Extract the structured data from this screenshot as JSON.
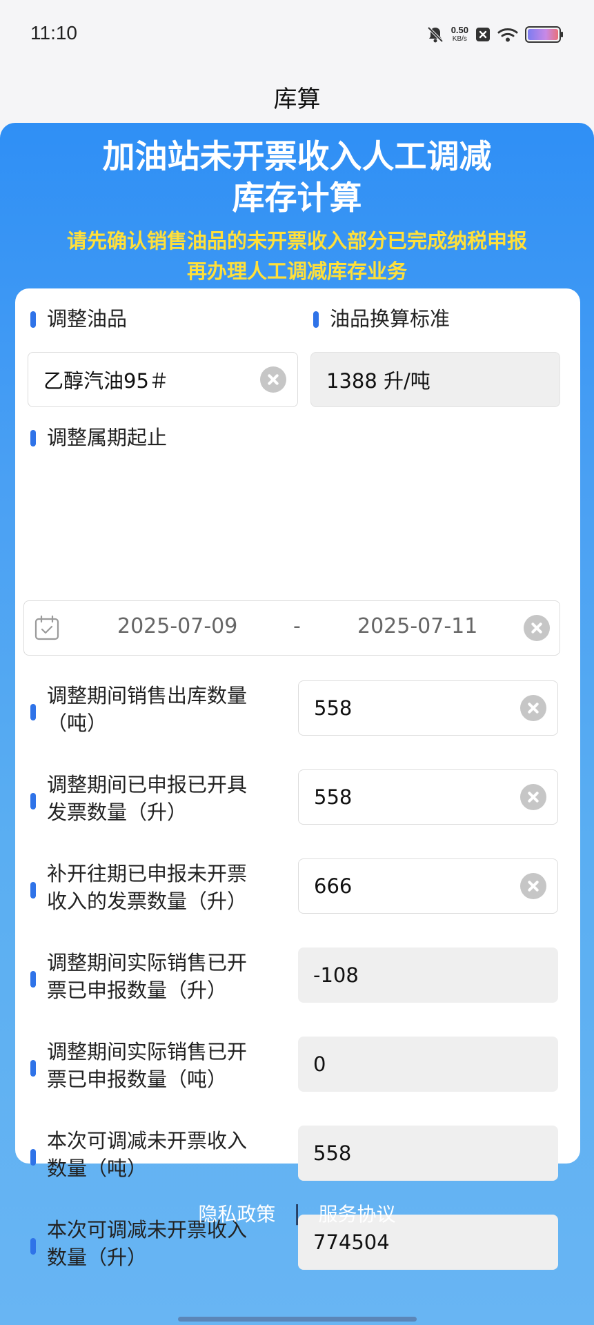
{
  "status_bar": {
    "time": "11:10",
    "net_speed_value": "0.50",
    "net_speed_unit": "KB/s",
    "icons": [
      "bell-muted-icon",
      "close-box-icon",
      "wifi-icon",
      "battery-icon"
    ]
  },
  "nav": {
    "title": "库算"
  },
  "banner": {
    "title_line1": "加油站未开票收入人工调减",
    "title_line2": "库存计算",
    "note_line1": "请先确认销售油品的未开票收入部分已完成纳税申报",
    "note_line2": "再办理人工调减库存业务"
  },
  "form": {
    "oil_label": "调整油品",
    "oil_value": "乙醇汽油95＃",
    "conversion_label": "油品换算标准",
    "conversion_value": "1388 升/吨",
    "period_label": "调整属期起止",
    "period_start": "2025-07-09",
    "period_separator": "-",
    "period_end": "2025-07-11",
    "rows": [
      {
        "label_line1": "调整期间销售出库数量",
        "label_line2": "（吨）",
        "value": "558",
        "editable": true
      },
      {
        "label_line1": "调整期间已申报已开具",
        "label_line2": "发票数量（升）",
        "value": "558",
        "editable": true
      },
      {
        "label_line1": "补开往期已申报未开票",
        "label_line2": "收入的发票数量（升）",
        "value": "666",
        "editable": true
      },
      {
        "label_line1": "调整期间实际销售已开",
        "label_line2": "票已申报数量（升）",
        "value": "-108",
        "editable": false
      },
      {
        "label_line1": "调整期间实际销售已开",
        "label_line2": "票已申报数量（吨）",
        "value": "0",
        "editable": false
      },
      {
        "label_line1": "本次可调减未开票收入",
        "label_line2": "数量（吨）",
        "value": "558",
        "editable": false
      },
      {
        "label_line1": "本次可调减未开票收入",
        "label_line2": "数量（升）",
        "value": "774504",
        "editable": false
      }
    ]
  },
  "footer": {
    "privacy_link": "隐私政策",
    "divider": "|",
    "service_link": "服务协议"
  },
  "colors": {
    "brand_blue": "#2f8ff5",
    "accent_bar": "#2f73e8",
    "warning_text": "#ffe03a"
  }
}
